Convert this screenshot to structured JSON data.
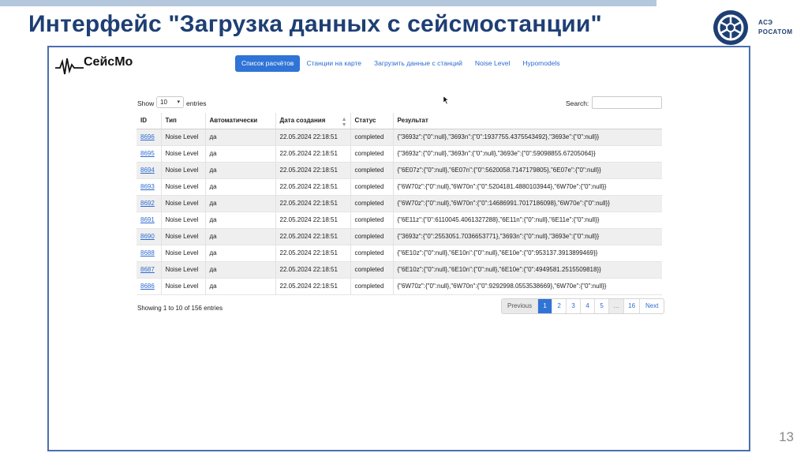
{
  "slide": {
    "title": "Интерфейс \"Загрузка данных с сейсмостанции\"",
    "page_number": "13",
    "logo_lines": [
      "АСЭ",
      "РОСАТОМ"
    ],
    "title_color": "#1e3f74",
    "accent_color": "#2f74d6"
  },
  "app": {
    "logo_text": "СейсМо",
    "logo_icon": "seismogram-wave-icon",
    "nav": [
      {
        "label": "Список расчётов",
        "active": true
      },
      {
        "label": "Станции на карте",
        "active": false
      },
      {
        "label": "Загрузить данные с станций",
        "active": false
      },
      {
        "label": "Noise Level",
        "active": false
      },
      {
        "label": "Hypomodels",
        "active": false
      }
    ],
    "controls": {
      "show_label": "Show",
      "entries_value": "10",
      "entries_label": "entries",
      "search_label": "Search:",
      "search_value": ""
    },
    "table": {
      "columns": [
        "ID",
        "Тип",
        "Автоматически",
        "Дата создания",
        "Статус",
        "Результат"
      ],
      "sorted_column": "Дата создания",
      "rows": [
        {
          "id": "8696",
          "type": "Noise Level",
          "auto": "да",
          "created": "22.05.2024 22:18:51",
          "status": "completed",
          "result": "{\"3693z\":{\"0\":null},\"3693n\":{\"0\":1937755.4375543492},\"3693e\":{\"0\":null}}"
        },
        {
          "id": "8695",
          "type": "Noise Level",
          "auto": "да",
          "created": "22.05.2024 22:18:51",
          "status": "completed",
          "result": "{\"3693z\":{\"0\":null},\"3693n\":{\"0\":null},\"3693e\":{\"0\":59098855.67205064}}"
        },
        {
          "id": "8694",
          "type": "Noise Level",
          "auto": "да",
          "created": "22.05.2024 22:18:51",
          "status": "completed",
          "result": "{\"6E07z\":{\"0\":null},\"6E07n\":{\"0\":5620058.7147179805},\"6E07e\":{\"0\":null}}"
        },
        {
          "id": "8693",
          "type": "Noise Level",
          "auto": "да",
          "created": "22.05.2024 22:18:51",
          "status": "completed",
          "result": "{\"6W70z\":{\"0\":null},\"6W70n\":{\"0\":5204181.4880103944},\"6W70e\":{\"0\":null}}"
        },
        {
          "id": "8692",
          "type": "Noise Level",
          "auto": "да",
          "created": "22.05.2024 22:18:51",
          "status": "completed",
          "result": "{\"6W70z\":{\"0\":null},\"6W70n\":{\"0\":14686991.7017186098},\"6W70e\":{\"0\":null}}"
        },
        {
          "id": "8691",
          "type": "Noise Level",
          "auto": "да",
          "created": "22.05.2024 22:18:51",
          "status": "completed",
          "result": "{\"6E11z\":{\"0\":6110045.4061327288},\"6E11n\":{\"0\":null},\"6E11e\":{\"0\":null}}"
        },
        {
          "id": "8690",
          "type": "Noise Level",
          "auto": "да",
          "created": "22.05.2024 22:18:51",
          "status": "completed",
          "result": "{\"3693z\":{\"0\":2553051.7036653771},\"3693n\":{\"0\":null},\"3693e\":{\"0\":null}}"
        },
        {
          "id": "8688",
          "type": "Noise Level",
          "auto": "да",
          "created": "22.05.2024 22:18:51",
          "status": "completed",
          "result": "{\"6E10z\":{\"0\":null},\"6E10n\":{\"0\":null},\"6E10e\":{\"0\":953137.3913899469}}"
        },
        {
          "id": "8687",
          "type": "Noise Level",
          "auto": "да",
          "created": "22.05.2024 22:18:51",
          "status": "completed",
          "result": "{\"6E10z\":{\"0\":null},\"6E10n\":{\"0\":null},\"6E10e\":{\"0\":4949581.2515509818}}"
        },
        {
          "id": "8686",
          "type": "Noise Level",
          "auto": "да",
          "created": "22.05.2024 22:18:51",
          "status": "completed",
          "result": "{\"6W70z\":{\"0\":null},\"6W70n\":{\"0\":9292998.0553538669},\"6W70e\":{\"0\":null}}"
        }
      ]
    },
    "info_text": "Showing 1 to 10 of 156 entries",
    "pagination": {
      "previous": "Previous",
      "pages": [
        "1",
        "2",
        "3",
        "4",
        "5",
        "…",
        "16"
      ],
      "active_page": "1",
      "next": "Next"
    }
  }
}
